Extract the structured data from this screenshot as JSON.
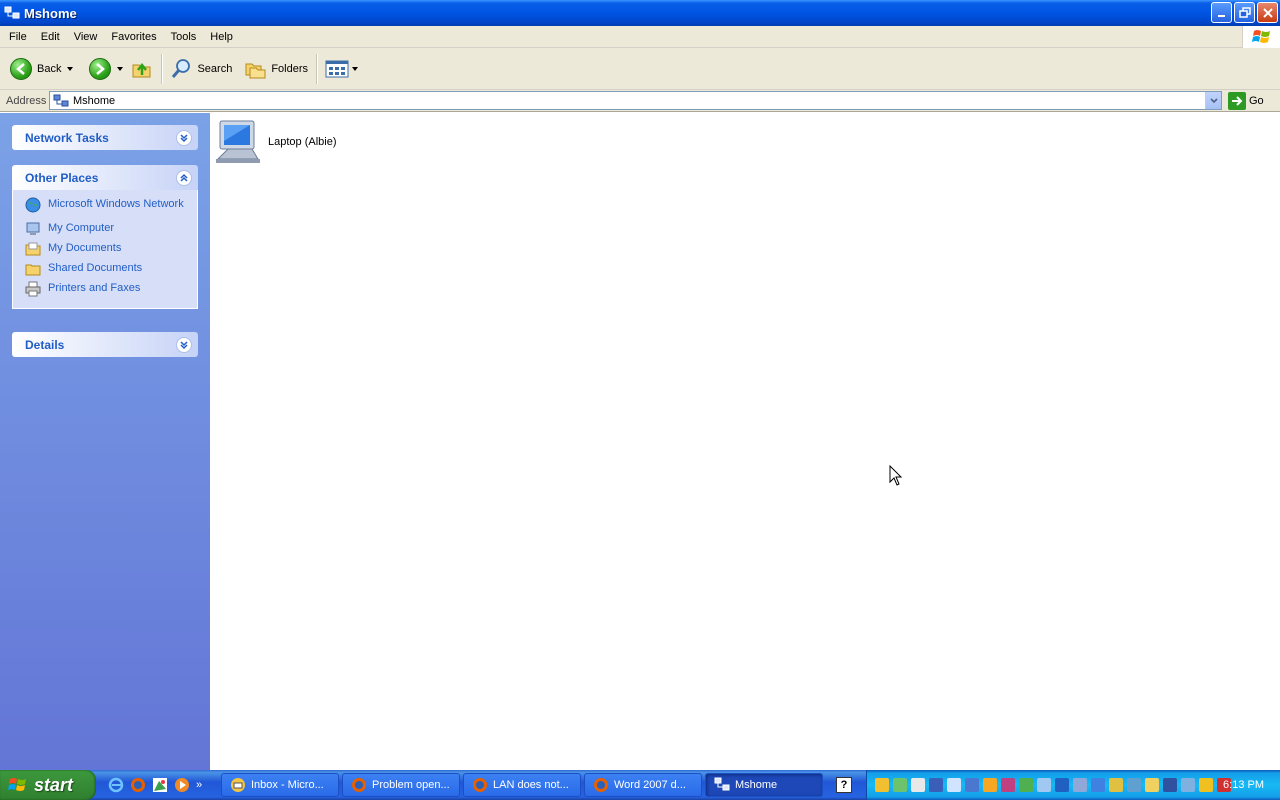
{
  "window": {
    "title": "Mshome"
  },
  "menubar": {
    "items": [
      "File",
      "Edit",
      "View",
      "Favorites",
      "Tools",
      "Help"
    ]
  },
  "toolbar": {
    "back_label": "Back",
    "search_label": "Search",
    "folders_label": "Folders"
  },
  "address": {
    "label": "Address",
    "value": "Mshome",
    "go_label": "Go"
  },
  "sidebar": {
    "network_tasks": {
      "title": "Network Tasks"
    },
    "other_places": {
      "title": "Other Places",
      "items": [
        {
          "label": "Microsoft Windows Network",
          "icon": "network-globe-icon"
        },
        {
          "label": "My Computer",
          "icon": "my-computer-icon"
        },
        {
          "label": "My Documents",
          "icon": "my-documents-icon"
        },
        {
          "label": "Shared Documents",
          "icon": "shared-documents-icon"
        },
        {
          "label": "Printers and Faxes",
          "icon": "printers-icon"
        }
      ]
    },
    "details": {
      "title": "Details"
    }
  },
  "content": {
    "items": [
      {
        "label": "Laptop (Albie)",
        "icon": "computer-icon"
      }
    ]
  },
  "taskbar": {
    "start_label": "start",
    "tasks": [
      {
        "label": "Inbox - Micro...",
        "active": false
      },
      {
        "label": "Problem open...",
        "active": false
      },
      {
        "label": "LAN does not...",
        "active": false
      },
      {
        "label": "Word 2007 d...",
        "active": false
      },
      {
        "label": "Mshome",
        "active": true
      }
    ],
    "clock": "6:13 PM"
  },
  "colors": {
    "title_bar": "#0054e3",
    "sidebar_link": "#215dc6",
    "start_green": "#388e38"
  }
}
